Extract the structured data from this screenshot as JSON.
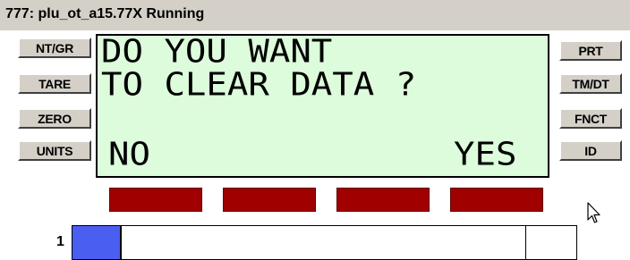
{
  "window": {
    "title": "777: plu_ot_a15.77X Running"
  },
  "left_buttons": [
    "NT/GR",
    "TARE",
    "ZERO",
    "UNITS"
  ],
  "right_buttons": [
    "PRT",
    "TM/DT",
    "FNCT",
    "ID"
  ],
  "display": {
    "line1": "DO YOU WANT",
    "line2": "TO CLEAR DATA ?",
    "softkey_left_label": "NO",
    "softkey_right_label": "YES",
    "background_color": "#dcfcdc"
  },
  "softkeys": {
    "count": 4,
    "color": "#a00000"
  },
  "scale_bar": {
    "label": "1",
    "fill_color": "#4a5ef0"
  },
  "cursor_icon": "arrow-cursor-icon"
}
